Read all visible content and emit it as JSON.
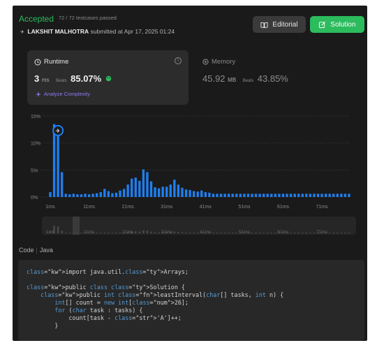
{
  "header": {
    "status": "Accepted",
    "testcases": "72 / 72 testcases passed",
    "user": "LAKSHIT MALHOTRA",
    "submitted_text": "submitted at Apr 17, 2025 01:24",
    "editorial_label": "Editorial",
    "solution_label": "Solution"
  },
  "runtime": {
    "title": "Runtime",
    "value": "3",
    "unit": "ms",
    "beats_label": "Beats",
    "beats_value": "85.07%",
    "analyze_label": "Analyze Complexity"
  },
  "memory": {
    "title": "Memory",
    "value": "45.92",
    "unit": "MB",
    "beats_label": "Beats",
    "beats_value": "43.85%"
  },
  "chart_data": {
    "type": "bar",
    "yticks": [
      "15%",
      "10%",
      "5%",
      "0%"
    ],
    "xticks": [
      "1ms",
      "11ms",
      "21ms",
      "31ms",
      "41ms",
      "51ms",
      "61ms",
      "71ms"
    ],
    "x": [
      0,
      1,
      2,
      3,
      4,
      5,
      6,
      7,
      8,
      9,
      10,
      11,
      12,
      13,
      14,
      15,
      16,
      17,
      18,
      19,
      20,
      21,
      22,
      23,
      24,
      25,
      26,
      27,
      28,
      29,
      30,
      31,
      32,
      33,
      34,
      35,
      36,
      37,
      38,
      39,
      40,
      41,
      42,
      43,
      44,
      45,
      46,
      47,
      48,
      49,
      50,
      51,
      52,
      53,
      54,
      55,
      56,
      57,
      58,
      59,
      60,
      61,
      62,
      63,
      64,
      65,
      66,
      67,
      68,
      69,
      70,
      71,
      72,
      73,
      74,
      75,
      76,
      77
    ],
    "values": [
      0.9,
      13.5,
      12.3,
      4.6,
      0.6,
      0.5,
      0.6,
      0.5,
      0.5,
      0.6,
      0.5,
      0.6,
      0.7,
      0.9,
      1.5,
      1.1,
      0.7,
      0.8,
      1.2,
      1.5,
      2.3,
      3.4,
      3.6,
      3.0,
      5.1,
      4.6,
      2.9,
      1.8,
      1.6,
      1.9,
      1.9,
      2.3,
      3.2,
      2.3,
      1.7,
      1.4,
      1.3,
      1.1,
      1.0,
      1.2,
      0.9,
      0.8,
      0.6,
      0.6,
      0.6,
      0.6,
      0.6,
      0.6,
      0.6,
      0.6,
      0.6,
      0.6,
      0.6,
      0.6,
      0.6,
      0.6,
      0.6,
      0.6,
      0.6,
      0.6,
      0.6,
      0.6,
      0.6,
      0.6,
      0.6,
      0.6,
      0.6,
      0.6,
      0.6,
      0.6,
      0.6,
      0.6,
      0.6,
      0.6,
      0.6,
      0.6,
      0.6,
      0.6
    ],
    "ylim": [
      0,
      15
    ],
    "highlight_index": 2,
    "bar_color": "#1f7ff0",
    "grid": true
  },
  "overview": {
    "labels": [
      "1ms",
      "11ms",
      "21ms",
      "31ms",
      "41ms",
      "51ms",
      "61ms",
      "71ms"
    ]
  },
  "code_section": {
    "title": "Code",
    "language": "Java"
  },
  "code_lines": [
    "import java.util.Arrays;",
    "",
    "public class Solution {",
    "    public int leastInterval(char[] tasks, int n) {",
    "        int[] count = new int[26];",
    "        for (char task : tasks) {",
    "            count[task - 'A']++;",
    "        }"
  ],
  "colors": {
    "accepted": "#2cbb5d",
    "accent_blue": "#1f7ff0",
    "analyze_purple": "#8b7cf6",
    "background": "#1a1a1a",
    "card": "#2c2c2c"
  }
}
